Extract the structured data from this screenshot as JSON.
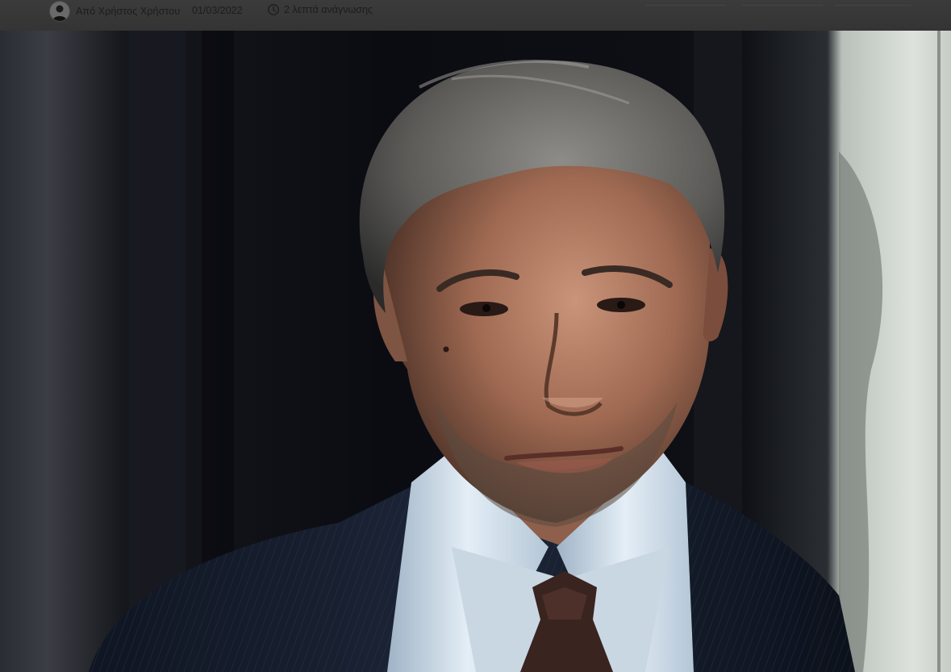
{
  "article_meta": {
    "author": "Από Χρήστος Χρήστου",
    "date": "01/03/2022",
    "reading_time": "2 λεπτά ανάγνωσης",
    "author_avatar_icon": "author-avatar",
    "clock_icon": "clock-icon"
  },
  "featured_image": {
    "subject": "portrait photo",
    "colors": {
      "background": "#0d0f15",
      "wall_right": "#c9d0c8",
      "shirt": "#d8e4ee",
      "suit": "#1a2236",
      "tie": "#3a2420",
      "skin": "#b07a60",
      "hair": "#6b6b68"
    }
  }
}
